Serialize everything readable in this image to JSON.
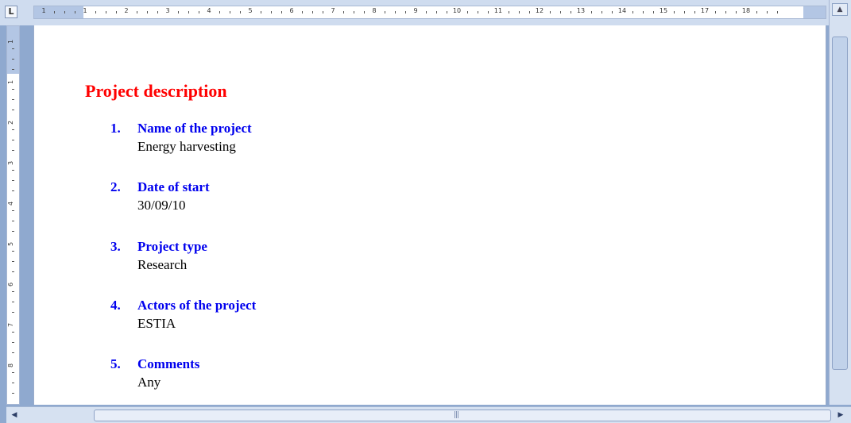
{
  "ruler": {
    "tab_selector": "L",
    "h_numbers": [
      "1",
      "1",
      "2",
      "3",
      "4",
      "5",
      "6",
      "7",
      "8",
      "9",
      "10",
      "11",
      "12",
      "13",
      "14",
      "15",
      "17",
      "18"
    ],
    "v_numbers": [
      "1",
      "1",
      "2",
      "3",
      "4",
      "5",
      "6",
      "7",
      "8"
    ]
  },
  "document": {
    "title": "Project description",
    "items": [
      {
        "num": "1.",
        "heading": "Name of the project",
        "value": "Energy harvesting"
      },
      {
        "num": "2.",
        "heading": "Date of start",
        "value": "30/09/10"
      },
      {
        "num": "3.",
        "heading": "Project type",
        "value": "Research"
      },
      {
        "num": "4.",
        "heading": "Actors of the project",
        "value": "ESTIA"
      },
      {
        "num": "5.",
        "heading": "Comments",
        "value": "Any"
      }
    ]
  },
  "scrollbars": {
    "up_icon": "scroll-up-arrow-icon",
    "left_icon": "scroll-left-arrow-icon",
    "right_icon": "scroll-right-arrow-icon",
    "grip_icon": "grip-icon"
  },
  "colors": {
    "title": "#ff0000",
    "heading": "#0000ee",
    "ruler_bg": "#cfdcef"
  }
}
